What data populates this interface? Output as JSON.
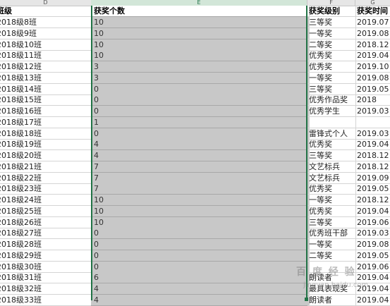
{
  "columns": {
    "D": "D",
    "E": "E",
    "F": "F",
    "G": "G"
  },
  "headers": {
    "class": "班级",
    "count": "获奖个数",
    "level": "获奖级别",
    "time": "获奖时间"
  },
  "rows": [
    {
      "class": "2018级8班",
      "count": "10",
      "level": "三等奖",
      "time": "2019.07"
    },
    {
      "class": "2018级9班",
      "count": "10",
      "level": "一等奖",
      "time": "2019.08"
    },
    {
      "class": "2018级10班",
      "count": "10",
      "level": "二等奖",
      "time": "2018.12"
    },
    {
      "class": "2018级11班",
      "count": "10",
      "level": "优秀奖",
      "time": "2019.04"
    },
    {
      "class": "2018级12班",
      "count": "3",
      "level": "优秀奖",
      "time": "2019.10"
    },
    {
      "class": "2018级13班",
      "count": "3",
      "level": "一等奖",
      "time": "2019.08"
    },
    {
      "class": "2018级14班",
      "count": "0",
      "level": "三等奖",
      "time": "2019.05"
    },
    {
      "class": "2018级15班",
      "count": "0",
      "level": "优秀作品奖",
      "time": "2018"
    },
    {
      "class": "2018级16班",
      "count": "0",
      "level": "优秀学生",
      "time": "2019.03"
    },
    {
      "class": "2018级17班",
      "count": "1",
      "level": "",
      "time": ""
    },
    {
      "class": "2018级18班",
      "count": "0",
      "level": "雷锋式个人",
      "time": "2019.03"
    },
    {
      "class": "2018级19班",
      "count": "4",
      "level": "优秀奖",
      "time": "2019.04"
    },
    {
      "class": "2018级20班",
      "count": "4",
      "level": "三等奖",
      "time": "2018.12"
    },
    {
      "class": "2018级21班",
      "count": "7",
      "level": "文艺标兵",
      "time": "2018.12"
    },
    {
      "class": "2018级22班",
      "count": "7",
      "level": "文艺标兵",
      "time": "2019.09"
    },
    {
      "class": "2018级23班",
      "count": "7",
      "level": "优秀奖",
      "time": "2019.05"
    },
    {
      "class": "2018级24班",
      "count": "10",
      "level": "一等奖",
      "time": "2018.12"
    },
    {
      "class": "2018级25班",
      "count": "10",
      "level": "优秀奖",
      "time": "2019.04"
    },
    {
      "class": "2018级26班",
      "count": "10",
      "level": "三等奖",
      "time": "2019.06"
    },
    {
      "class": "2018级27班",
      "count": "0",
      "level": "优秀班干部",
      "time": "2019.03"
    },
    {
      "class": "2018级28班",
      "count": "0",
      "level": "一等奖",
      "time": "2019.08"
    },
    {
      "class": "2018级29班",
      "count": "0",
      "level": "二等奖",
      "time": "2019.05"
    },
    {
      "class": "2018级30班",
      "count": "0",
      "level": "",
      "time": "2019.06"
    },
    {
      "class": "2018级31班",
      "count": "6",
      "level": "朗读者",
      "time": "2019.04"
    },
    {
      "class": "2018级32班",
      "count": "4",
      "level": "最具表现奖",
      "time": "2019.04"
    },
    {
      "class": "2018级33班",
      "count": "4",
      "level": "朗读者",
      "time": "2019.04"
    }
  ],
  "colors": {
    "selection": "#217346",
    "selected_fill": "#c8c8c8"
  }
}
